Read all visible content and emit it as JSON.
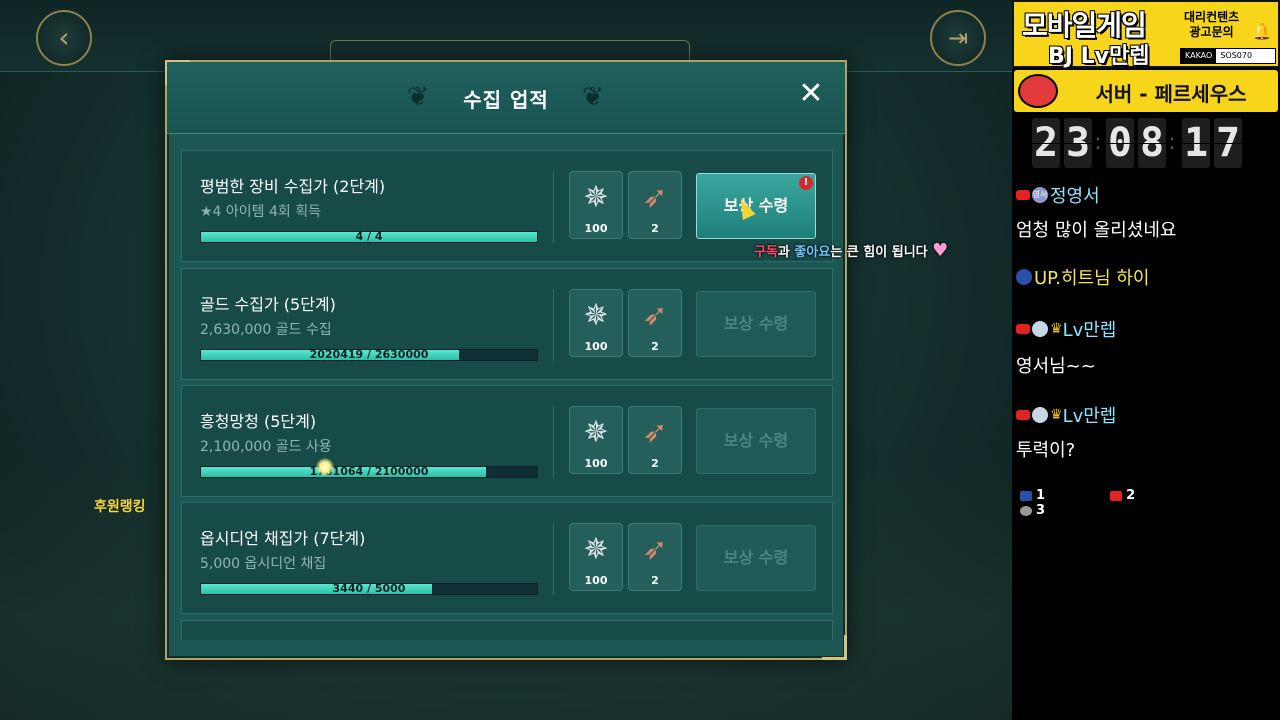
{
  "dialog": {
    "title": "수집 업적",
    "close_icon": "close-icon"
  },
  "achievements": [
    {
      "name": "평범한 장비 수집가 (2단계)",
      "description": "★4 아이템 4회 획득",
      "progress_text": "4 / 4",
      "progress_fraction": 1.0,
      "rewards": [
        {
          "icon": "silver-medal-icon",
          "qty": "100"
        },
        {
          "icon": "bow-arrow-icon",
          "qty": "2"
        }
      ],
      "claim_label": "보상 수령",
      "claimable": true
    },
    {
      "name": "골드 수집가 (5단계)",
      "description": "2,630,000 골드 수집",
      "progress_text": "2020419 / 2630000",
      "progress_fraction": 0.768,
      "rewards": [
        {
          "icon": "silver-medal-icon",
          "qty": "100"
        },
        {
          "icon": "bow-arrow-icon",
          "qty": "2"
        }
      ],
      "claim_label": "보상 수령",
      "claimable": false
    },
    {
      "name": "흥청망청 (5단계)",
      "description": "2,100,000 골드 사용",
      "progress_text": "1781064 / 2100000",
      "progress_fraction": 0.848,
      "rewards": [
        {
          "icon": "silver-medal-icon",
          "qty": "100"
        },
        {
          "icon": "bow-arrow-icon",
          "qty": "2"
        }
      ],
      "claim_label": "보상 수령",
      "claimable": false
    },
    {
      "name": "옵시디언 채집가 (7단계)",
      "description": "5,000 옵시디언 채집",
      "progress_text": "3440 / 5000",
      "progress_fraction": 0.688,
      "rewards": [
        {
          "icon": "silver-medal-icon",
          "qty": "100"
        },
        {
          "icon": "bow-arrow-icon",
          "qty": "2"
        }
      ],
      "claim_label": "보상 수령",
      "claimable": false
    }
  ],
  "overlay": {
    "ranking_label": "후원랭킹",
    "subscribe_red": "구독",
    "subscribe_mid": "과",
    "subscribe_blue": "좋아요",
    "subscribe_rest": "는 큰 힘이 됩니다"
  },
  "side": {
    "banner_title": "모바일게임",
    "banner_sub": "BJ Lv만렙",
    "banner_ad": "대리컨텐츠\n광고문의",
    "kakao_label": "KAKAO",
    "kakao_id": "SOS070",
    "server": "서버 - 페르세우스",
    "clock": [
      "2",
      "3",
      "0",
      "8",
      "1",
      "7"
    ],
    "chat": [
      {
        "user": "정영서",
        "avatar": "영서",
        "text": "엄청 많이 올리셨네요"
      },
      {
        "user": "UP.히트님 하이",
        "text": ""
      },
      {
        "user": "Lv만렙",
        "text": "영서님~~"
      },
      {
        "user": "Lv만렙",
        "text": "투력이?"
      }
    ],
    "counters": [
      "1",
      "2",
      "3"
    ]
  },
  "colors": {
    "dialog_bg": "#1c5754",
    "progress": "#2bbfa8",
    "banner": "#f7d51a",
    "claim_active": "#1f7f79"
  }
}
